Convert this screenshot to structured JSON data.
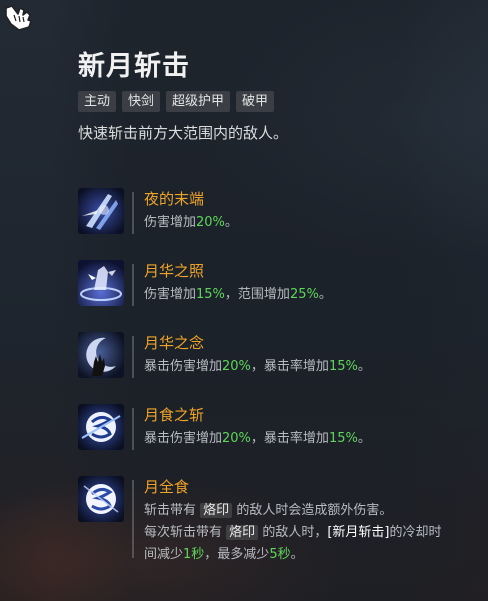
{
  "skill": {
    "title": "新月斩击",
    "tags": [
      "主动",
      "快剑",
      "超级护甲",
      "破甲"
    ],
    "description": "快速斩击前方大范围内的敌人。"
  },
  "runes": [
    {
      "name": "夜的末端",
      "icon": "night-end-icon",
      "line1": [
        "伤害增加",
        "20%",
        "。"
      ]
    },
    {
      "name": "月华之照",
      "icon": "moonlight-shine-icon",
      "line1": [
        "伤害增加",
        "15%",
        "，范围增加",
        "25%",
        "。"
      ]
    },
    {
      "name": "月华之念",
      "icon": "moonlight-thought-icon",
      "line1": [
        "暴击伤害增加",
        "20%",
        "，暴击率增加",
        "15%",
        "。"
      ]
    },
    {
      "name": "月食之斩",
      "icon": "eclipse-slash-icon",
      "line1": [
        "暴击伤害增加",
        "20%",
        "，暴击率增加",
        "15%",
        "。"
      ]
    },
    {
      "name": "月全食",
      "icon": "total-eclipse-icon",
      "line1": [
        "斩击带有",
        "烙印",
        "的敌人时会造成额外伤害。"
      ],
      "line2": [
        "每次斩击带有",
        "烙印",
        "的敌人时，",
        "[新月斩击]",
        "的冷却时"
      ],
      "line3": [
        "间减少",
        "1秒",
        "，最多减少",
        "5秒",
        "。"
      ]
    }
  ],
  "colors": {
    "rune_name": "#f0a427",
    "number_highlight": "#5ed65a",
    "tag_bg": "#3b3f45"
  }
}
